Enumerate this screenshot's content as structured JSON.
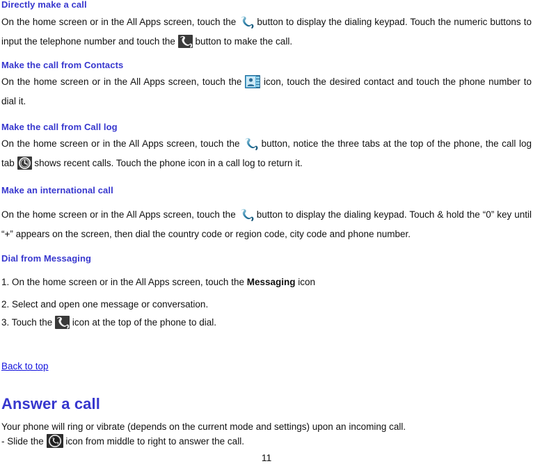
{
  "document": {
    "page_number": "11",
    "heading_color": "#3737CE",
    "link_color": "#1414DD",
    "sections": [
      {
        "id": "directly-make-a-call",
        "heading": "Directly make a call",
        "body_part1": "On the home screen or in the All Apps screen, touch the",
        "body_part2": "button to display the dialing keypad. Touch the numeric buttons to input the telephone number and touch the",
        "body_part3": "button to make the call."
      },
      {
        "id": "make-the-call-from-contacts",
        "heading": "Make the call from Contacts",
        "body_part1": "On the home screen or in the All Apps screen, touch the",
        "body_part2": "icon, touch the desired contact and touch the phone number to dial it."
      },
      {
        "id": "make-the-call-from-call-log",
        "heading": "Make the call from Call log",
        "body_part1": "On the home screen or in the All Apps screen, touch the",
        "body_part2": "button, notice the three tabs at the top of the phone, the call log tab",
        "body_part3": "shows recent calls. Touch the phone icon in a call log to return it."
      },
      {
        "id": "make-an-international-call",
        "heading": "Make an international call",
        "body_part1": "On the home screen or in the All Apps screen, touch the",
        "body_part2": "button to display the dialing keypad. Touch & hold the “0” key until “+” appears on the screen, then dial the country code or region code, city code and phone number."
      },
      {
        "id": "dial-from-messaging",
        "heading": "Dial from Messaging",
        "step1_prefix": "1. On the home screen or in the All Apps screen, touch the",
        "step1_bold": "Messaging",
        "step1_suffix": "icon",
        "step2": "2. Select and open one message or conversation.",
        "step3_prefix": "3. Touch the",
        "step3_suffix": "icon at the top of the phone to dial."
      }
    ],
    "back_to_top": "Back to top",
    "answer_section": {
      "heading": "Answer a call",
      "line1": "Your phone will ring or vibrate (depends on the current mode and settings) upon an incoming call.",
      "line2_prefix": "- Slide the",
      "line2_suffix": "icon from middle to right to answer the call."
    },
    "icons": {
      "phone_light": "phone-handset-light-icon",
      "phone_dark": "phone-handset-dark-icon",
      "contacts": "contacts-app-icon",
      "call_log_clock": "call-log-clock-icon",
      "answer_call": "answer-call-circle-icon"
    }
  }
}
